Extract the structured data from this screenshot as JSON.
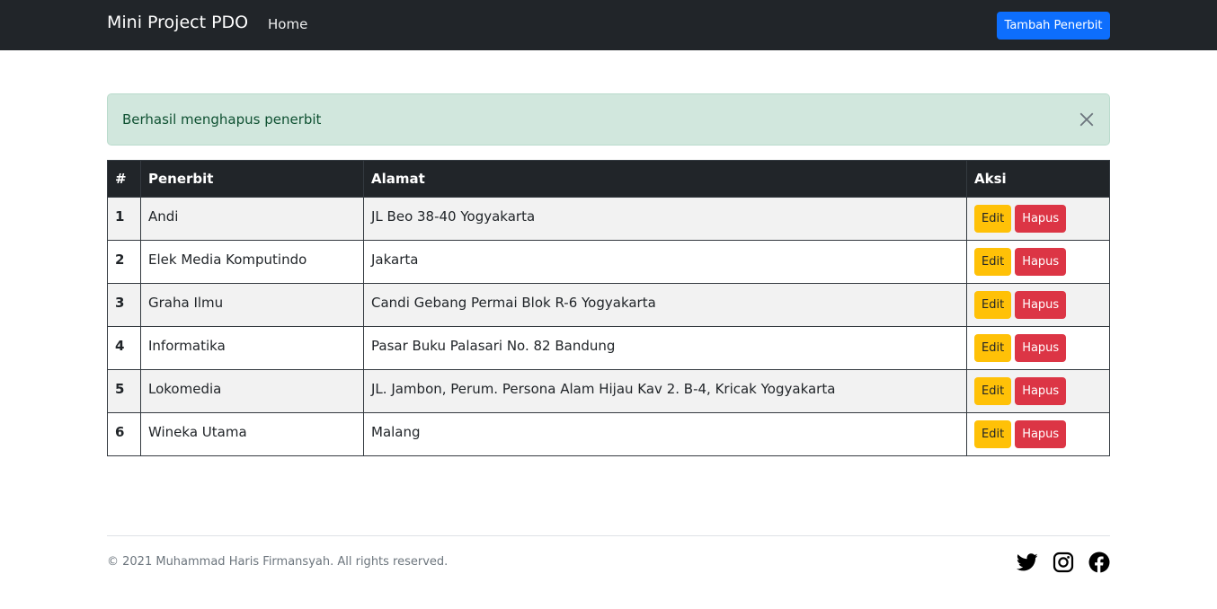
{
  "navbar": {
    "brand": "Mini Project PDO",
    "home_label": "Home",
    "add_button_label": "Tambah Penerbit"
  },
  "alert": {
    "message": "Berhasil menghapus penerbit"
  },
  "table": {
    "headers": [
      "#",
      "Penerbit",
      "Alamat",
      "Aksi"
    ],
    "rows": [
      {
        "no": "1",
        "penerbit": "Andi",
        "alamat": "JL Beo 38-40 Yogyakarta"
      },
      {
        "no": "2",
        "penerbit": "Elek Media Komputindo",
        "alamat": "Jakarta"
      },
      {
        "no": "3",
        "penerbit": "Graha Ilmu",
        "alamat": "Candi Gebang Permai Blok R-6 Yogyakarta"
      },
      {
        "no": "4",
        "penerbit": "Informatika",
        "alamat": "Pasar Buku Palasari No. 82 Bandung"
      },
      {
        "no": "5",
        "penerbit": "Lokomedia",
        "alamat": "JL. Jambon, Perum. Persona Alam Hijau Kav 2. B-4, Kricak Yogyakarta"
      },
      {
        "no": "6",
        "penerbit": "Wineka Utama",
        "alamat": "Malang"
      }
    ],
    "edit_label": "Edit",
    "delete_label": "Hapus"
  },
  "footer": {
    "copyright": "© 2021 Muhammad Haris Firmansyah. All rights reserved.",
    "social_icons": [
      "twitter-icon",
      "instagram-icon",
      "facebook-icon"
    ]
  },
  "colors": {
    "navbar_bg": "#212529",
    "primary": "#0d6efd",
    "warning": "#ffc107",
    "danger": "#dc3545",
    "alert_success_bg": "#d1e7dd"
  }
}
